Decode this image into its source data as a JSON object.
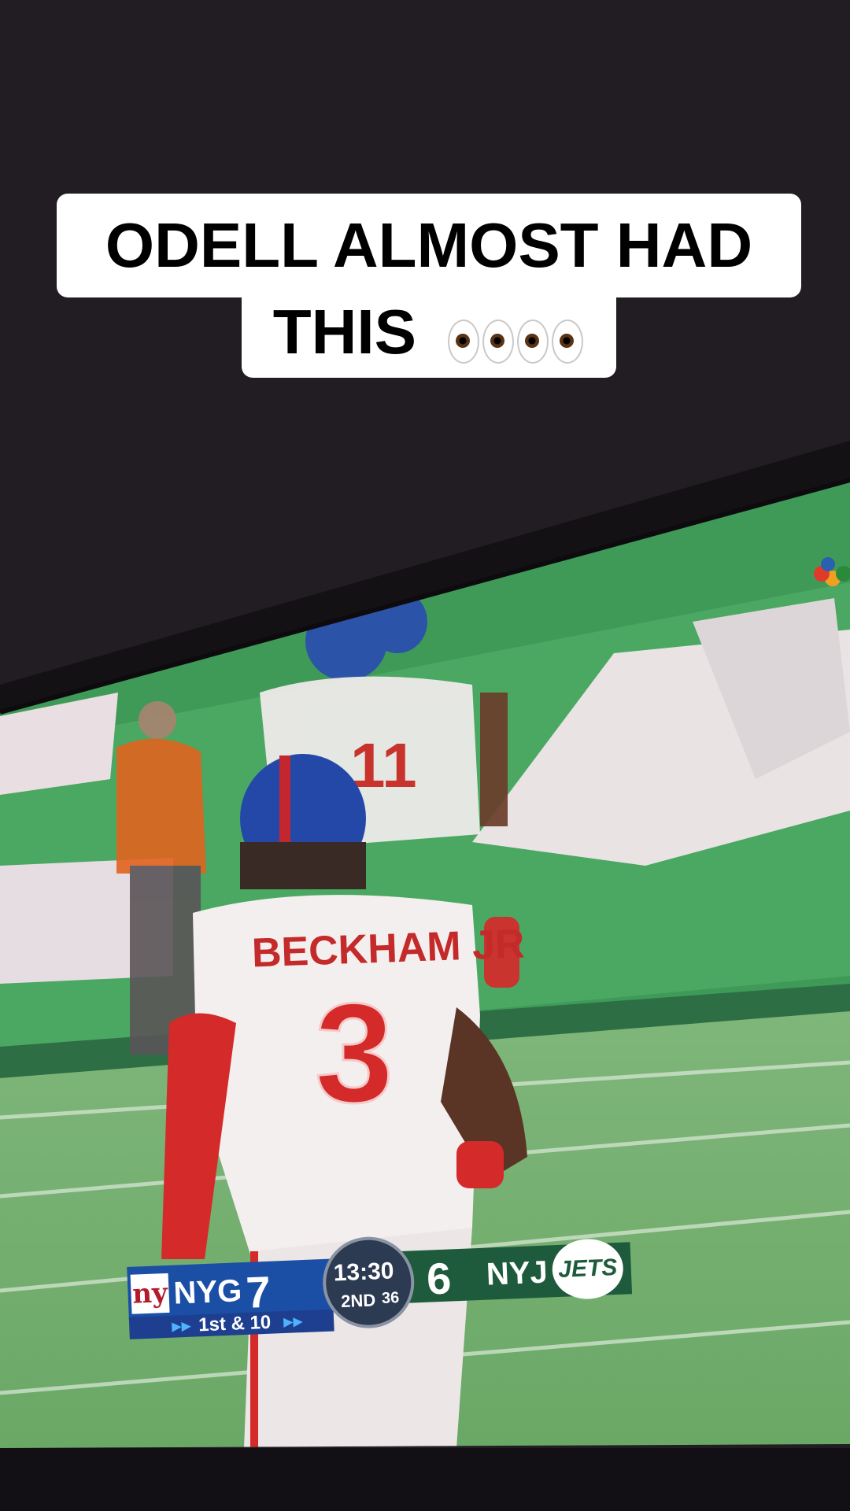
{
  "caption": {
    "line1": "ODELL ALMOST HAD",
    "line2": "THIS",
    "emoji": "👀👀"
  },
  "scorebug": {
    "home_abbr": "NYG",
    "home_score": "7",
    "clock": "13:30",
    "quarter": "2ND",
    "play_clock": "36",
    "away_score": "6",
    "away_abbr": "NYJ",
    "away_logo_text": "JETS",
    "down_distance": "1st & 10"
  },
  "jersey": {
    "name": "BECKHAM JR",
    "number": "3",
    "teammate_number": "11"
  },
  "colors": {
    "giants_blue": "#1b4fa6",
    "jets_green": "#1e5a3c",
    "giants_red": "#d42a2a",
    "background": "#211d22"
  }
}
